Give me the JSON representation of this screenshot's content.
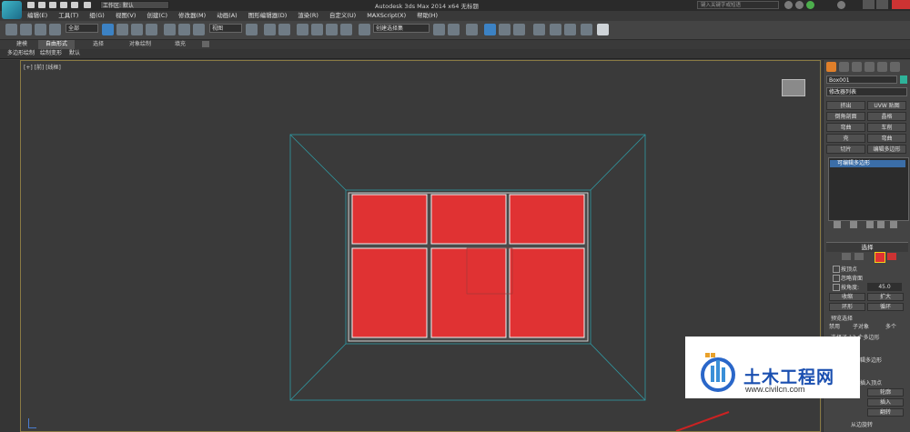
{
  "window": {
    "title": "Autodesk 3ds Max 2014 x64    无标题",
    "workspace": "工作区: 默认",
    "search_placeholder": "键入关键字或短语"
  },
  "menu": [
    "编辑(E)",
    "工具(T)",
    "组(G)",
    "视图(V)",
    "创建(C)",
    "修改器(M)",
    "动画(A)",
    "图形编辑器(D)",
    "渲染(R)",
    "自定义(U)",
    "MAXScript(X)",
    "帮助(H)"
  ],
  "toolbar": {
    "selection_filter": "全部",
    "ref_coord": "视图",
    "named_selection": "创建选择集"
  },
  "ribbon": {
    "tabs": [
      "建模",
      "自由形式",
      "选择",
      "对象绘制",
      "填充"
    ],
    "sub_tabs": [
      "多边形绘制",
      "绘制变形",
      "默认"
    ]
  },
  "viewport": {
    "label": "[+] [前] [线框]"
  },
  "command_panel": {
    "object_name": "Box001",
    "modifier_list": "修改器列表",
    "modifier_buttons": [
      [
        "挤出",
        "UVW 贴图"
      ],
      [
        "倒角剖面",
        "晶格"
      ],
      [
        "弯曲",
        "车削"
      ],
      [
        "壳",
        "弯曲"
      ],
      [
        "切片",
        "编辑多边形"
      ]
    ],
    "stack_item": "可编辑多边形",
    "selection_rollout": "选择",
    "by_vertex": "按顶点",
    "ignore_backfacing": "忽略背面",
    "by_angle": "按角度:",
    "angle_value": "45.0",
    "shrink": "收缩",
    "grow": "扩大",
    "ring": "环形",
    "loop": "循环",
    "preview_selection": "预览选择",
    "preview_disable": "禁用",
    "preview_subobject": "子对象",
    "preview_multi": "多个",
    "selected_count": "选择了 12 个多边形",
    "edit_polygons": "编辑多边形",
    "insert_vertex": "插入顶点",
    "outline": "轮廓",
    "inset": "插入",
    "flip": "翻转",
    "hinge_from_edge": "从边旋转"
  },
  "watermark": {
    "title": "土木工程网",
    "url": "www.civilcn.com"
  },
  "colors": {
    "accent_polygon": "#e03233",
    "wire": "#2f9aa4",
    "selection_blue": "#3c82c4"
  }
}
